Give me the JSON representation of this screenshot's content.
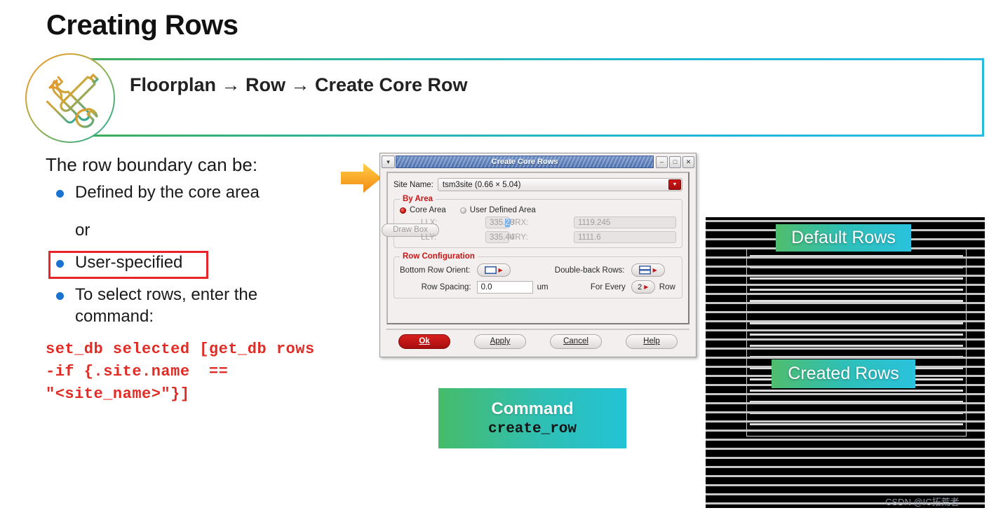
{
  "slide": {
    "title": "Creating Rows",
    "breadcrumb": "Floorplan → Row → Create Core Row",
    "tool_icon": "wrench-screwdriver-icon"
  },
  "content": {
    "lead": "The row boundary can be:",
    "bullets": [
      {
        "text": "Defined by the core area",
        "highlighted": false
      },
      {
        "text": "User-specified",
        "highlighted": true
      },
      {
        "text": "To select rows, enter the command:",
        "highlighted": false
      }
    ],
    "or_connector": "or",
    "code": "set_db selected [get_db rows\n-if {.site.name  ==\n\"<site_name>\"}]",
    "highlight_color": "#e8262a",
    "bullet_color": "#1a73d0",
    "code_color": "#e22b25"
  },
  "arrow": {
    "name": "orange-right-arrow",
    "color": "#f59c1a"
  },
  "dialog": {
    "title": "Create Core Rows",
    "menu_glyph": "▾",
    "titlebar_buttons": [
      {
        "name": "minimize",
        "glyph": "–"
      },
      {
        "name": "maximize",
        "glyph": "□"
      },
      {
        "name": "close",
        "glyph": "✕"
      }
    ],
    "site": {
      "label": "Site Name:",
      "value": "tsm3site   (0.66 × 5.04)",
      "dropdown_glyph": "▼",
      "dropdown_color": "#c01414"
    },
    "by_area": {
      "legend": "By Area",
      "options": [
        {
          "label": "Core Area",
          "selected": true
        },
        {
          "label": "User Defined Area",
          "selected": false
        }
      ],
      "fields": [
        {
          "label": "LLX:",
          "value": "335.28",
          "sel_start": 4,
          "sel_len": 1
        },
        {
          "label": "URX:",
          "value": "1119.245"
        },
        {
          "label": "LLY:",
          "value": "335.44"
        },
        {
          "label": "URY:",
          "value": "1111.6"
        }
      ],
      "draw_box_label": "Draw Box"
    },
    "row_config": {
      "legend": "Row Configuration",
      "bottom_row_orient_label": "Bottom Row Orient:",
      "bottom_row_orient_icon": "single-row-icon",
      "double_back_label": "Double-back Rows:",
      "double_back_icon": "double-row-icon",
      "row_spacing_label": "Row Spacing:",
      "row_spacing_value": "0.0",
      "row_spacing_unit": "um",
      "for_every_label": "For Every",
      "for_every_value": "2",
      "for_every_suffix": "Row"
    },
    "buttons": [
      {
        "id": "ok",
        "label": "Ok",
        "mnemonic": "O",
        "primary": true
      },
      {
        "id": "apply",
        "label": "Apply",
        "mnemonic": "A",
        "primary": false
      },
      {
        "id": "cancel",
        "label": "Cancel",
        "mnemonic": "C",
        "primary": false
      },
      {
        "id": "help",
        "label": "Help",
        "mnemonic": "H",
        "primary": false
      }
    ]
  },
  "command_badge": {
    "title": "Command",
    "code": "create_row"
  },
  "figure": {
    "default_rows_label": "Default Rows",
    "created_rows_label": "Created Rows",
    "badge_gradient_start": "#4fbd6d",
    "badge_gradient_end": "#2ac2dd"
  },
  "watermark": "CSDN @IC拓荒者"
}
